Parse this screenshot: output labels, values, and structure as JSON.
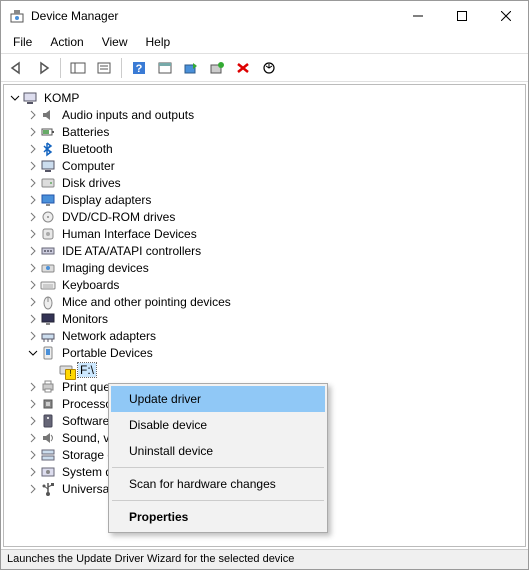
{
  "window": {
    "title": "Device Manager"
  },
  "menu": {
    "file": "File",
    "action": "Action",
    "view": "View",
    "help": "Help"
  },
  "tree": {
    "root": "KOMP",
    "items": [
      {
        "label": "Audio inputs and outputs",
        "icon": "speaker"
      },
      {
        "label": "Batteries",
        "icon": "battery"
      },
      {
        "label": "Bluetooth",
        "icon": "bluetooth"
      },
      {
        "label": "Computer",
        "icon": "computer"
      },
      {
        "label": "Disk drives",
        "icon": "disk"
      },
      {
        "label": "Display adapters",
        "icon": "display"
      },
      {
        "label": "DVD/CD-ROM drives",
        "icon": "optical"
      },
      {
        "label": "Human Interface Devices",
        "icon": "hid"
      },
      {
        "label": "IDE ATA/ATAPI controllers",
        "icon": "ide"
      },
      {
        "label": "Imaging devices",
        "icon": "imaging"
      },
      {
        "label": "Keyboards",
        "icon": "keyboard"
      },
      {
        "label": "Mice and other pointing devices",
        "icon": "mouse"
      },
      {
        "label": "Monitors",
        "icon": "monitor"
      },
      {
        "label": "Network adapters",
        "icon": "network"
      },
      {
        "label": "Portable Devices",
        "icon": "portable",
        "expanded": true,
        "children": [
          {
            "label": "F:\\",
            "icon": "drive-warn",
            "selected": true
          }
        ]
      },
      {
        "label": "Print queues",
        "icon": "printer"
      },
      {
        "label": "Processors",
        "icon": "cpu"
      },
      {
        "label": "Software devices",
        "icon": "software"
      },
      {
        "label": "Sound, video and game controllers",
        "icon": "sound"
      },
      {
        "label": "Storage controllers",
        "icon": "storage"
      },
      {
        "label": "System devices",
        "icon": "system"
      },
      {
        "label": "Universal Serial Bus controllers",
        "icon": "usb"
      }
    ]
  },
  "context": {
    "update": "Update driver",
    "disable": "Disable device",
    "uninstall": "Uninstall device",
    "scan": "Scan for hardware changes",
    "properties": "Properties"
  },
  "status": "Launches the Update Driver Wizard for the selected device"
}
